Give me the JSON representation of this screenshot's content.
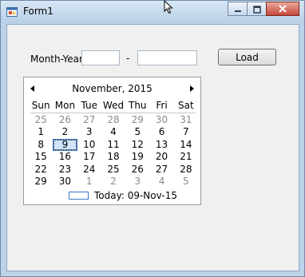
{
  "window": {
    "title": "Form1",
    "icon": "form-icon"
  },
  "caption_buttons": {
    "minimize_icon": "minimize-icon",
    "maximize_icon": "maximize-icon",
    "close_icon": "close-icon"
  },
  "form": {
    "month_year_label": "Month-Year",
    "separator": "-",
    "month_value": "",
    "year_value": "",
    "load_label": "Load"
  },
  "calendar": {
    "title": "November, 2015",
    "prev_icon": "left-arrow-icon",
    "next_icon": "right-arrow-icon",
    "dow": [
      "Sun",
      "Mon",
      "Tue",
      "Wed",
      "Thu",
      "Fri",
      "Sat"
    ],
    "weeks": [
      [
        "25",
        "26",
        "27",
        "28",
        "29",
        "30",
        "31"
      ],
      [
        "1",
        "2",
        "3",
        "4",
        "5",
        "6",
        "7"
      ],
      [
        "8",
        "9",
        "10",
        "11",
        "12",
        "13",
        "14"
      ],
      [
        "15",
        "16",
        "17",
        "18",
        "19",
        "20",
        "21"
      ],
      [
        "22",
        "23",
        "24",
        "25",
        "26",
        "27",
        "28"
      ],
      [
        "29",
        "30",
        "1",
        "2",
        "3",
        "4",
        "5"
      ]
    ],
    "selected_day": "9",
    "today_label": "Today: 09-Nov-15"
  },
  "colors": {
    "accent": "#3a78c8",
    "close_button": "#c7473a"
  }
}
